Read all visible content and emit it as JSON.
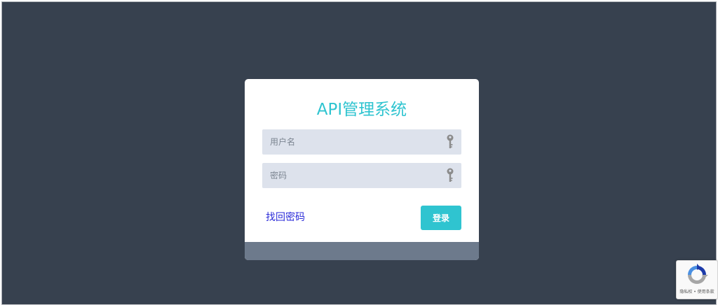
{
  "login": {
    "title": "API管理系统",
    "username_placeholder": "用户名",
    "password_placeholder": "密码",
    "forgot_label": "找回密码",
    "login_label": "登录"
  },
  "recaptcha": {
    "terms": "隐私权 • 使用条款"
  },
  "colors": {
    "background": "#37414f",
    "accent": "#2fc4d0",
    "input_bg": "#dde2ec",
    "card_footer": "#6d7a8c",
    "link": "#2a2ad8"
  },
  "icons": {
    "field_icon": "key-icon",
    "recaptcha": "recaptcha-logo-icon"
  }
}
